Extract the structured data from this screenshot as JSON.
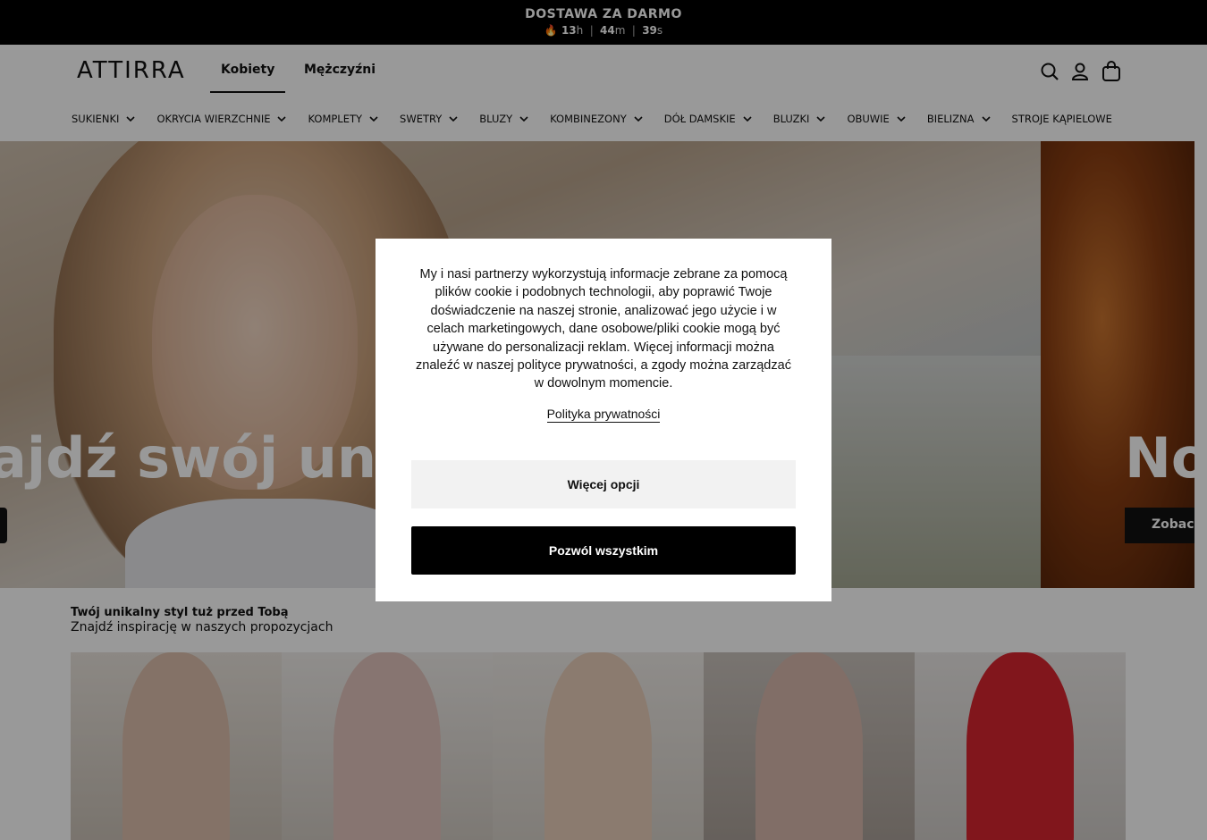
{
  "topbar": {
    "promo": "DOSTAWA ZA DARMO",
    "icon": "fire-icon",
    "timer": {
      "h": "13",
      "h_unit": "h",
      "m": "44",
      "m_unit": "m",
      "s": "39",
      "s_unit": "s"
    }
  },
  "header": {
    "logo": "ATTIRRA",
    "tabs": [
      {
        "label": "Kobiety",
        "active": true
      },
      {
        "label": "Mężczyźni",
        "active": false
      }
    ],
    "icons": [
      "search-icon",
      "user-icon",
      "bag-icon"
    ]
  },
  "categories": [
    "SUKIENKI",
    "OKRYCIA WIERZCHNIE",
    "KOMPLETY",
    "SWETRY",
    "BLUZY",
    "KOMBINEZONY",
    "DÓŁ DAMSKIE",
    "BLUZKI",
    "OBUWIE",
    "BIELIZNA",
    "STROJE KĄPIELOWE"
  ],
  "hero": {
    "slide1_headline": "ajdź swój unika",
    "slide2_headline": "No",
    "slide2_button": "Zobacz"
  },
  "section": {
    "title": "Twój unikalny styl tuż przed Tobą",
    "subtitle": "Znajdź inspirację w naszych propozycjach"
  },
  "products": [
    {
      "color": "#dcbfac"
    },
    {
      "color": "#e2c4bc"
    },
    {
      "color": "#e8cdb9"
    },
    {
      "color": "#d7b7ac"
    },
    {
      "color": "#d8262f"
    }
  ],
  "cookie_modal": {
    "text": "My i nasi partnerzy wykorzystują informacje zebrane za pomocą plików cookie i podobnych technologii, aby poprawić Twoje doświadczenie na naszej stronie, analizować jego użycie i w celach marketingowych, dane osobowe/pliki cookie mogą być używane do personalizacji reklam. Więcej informacji można znaleźć w naszej polityce prywatności, a zgody można zarządzać w dowolnym momencie.",
    "privacy_link": "Polityka prywatności",
    "more_options": "Więcej opcji",
    "allow_all": "Pozwól wszystkim"
  }
}
